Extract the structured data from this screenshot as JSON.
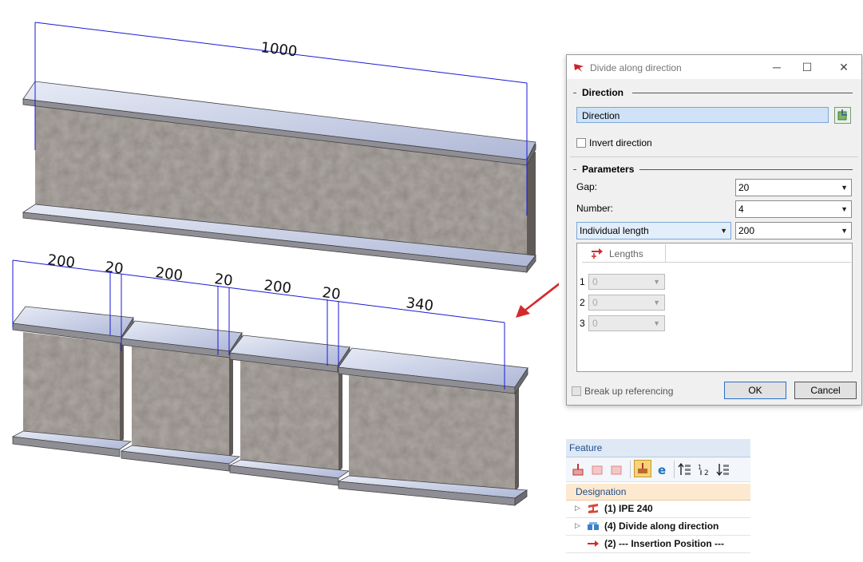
{
  "scene": {
    "top_beam_dimension": "1000",
    "segment_dimensions": [
      "200",
      "20",
      "200",
      "20",
      "200",
      "20",
      "340"
    ]
  },
  "dialog": {
    "title": "Divide along direction",
    "minimize_label": "─",
    "maximize_label": "☐",
    "close_label": "✕",
    "direction_section": "Direction",
    "direction_field": "Direction",
    "invert_direction_label": "Invert direction",
    "parameters_section": "Parameters",
    "gap_label": "Gap:",
    "gap_value": "20",
    "number_label": "Number:",
    "number_value": "4",
    "mode_value": "Individual length",
    "mode_length_value": "200",
    "lengths_tab_label": "Lengths",
    "length_rows": [
      {
        "index": "1",
        "value": "0"
      },
      {
        "index": "2",
        "value": "0"
      },
      {
        "index": "3",
        "value": "0"
      }
    ],
    "break_up_label": "Break up referencing",
    "ok_label": "OK",
    "cancel_label": "Cancel"
  },
  "feature_panel": {
    "title": "Feature",
    "column_header": "Designation",
    "rows": [
      {
        "label": "(1) IPE 240",
        "icon": "ipe-beam-icon"
      },
      {
        "label": "(4) Divide along direction",
        "icon": "divide-icon"
      },
      {
        "label": "(2) --- Insertion Position ---",
        "icon": "insertion-arrow-icon"
      }
    ]
  },
  "colors": {
    "dimension_line": "#1a1ad6",
    "pointer_arrow": "#d42a2a",
    "flange": "#b9c2dd",
    "web": "#8f8884"
  }
}
